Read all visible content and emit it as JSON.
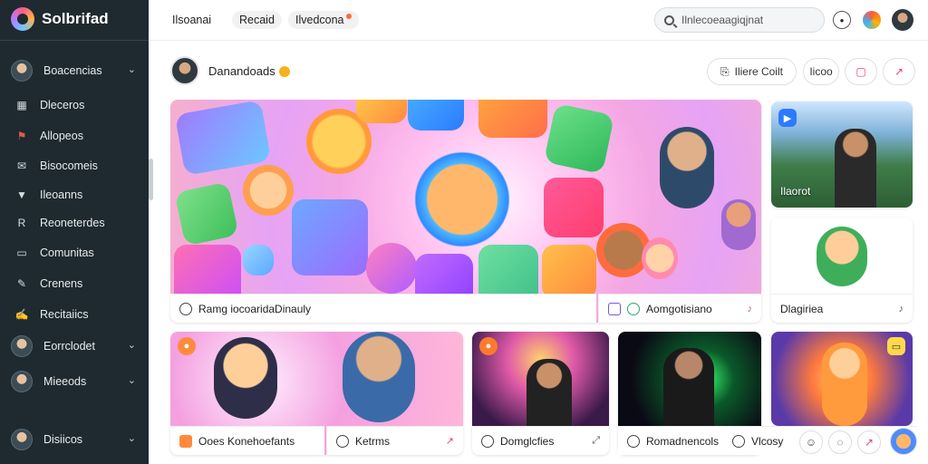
{
  "app": {
    "brand": "Solbrifad"
  },
  "sidebar": {
    "items": [
      {
        "label": "Boacencias",
        "type": "group"
      },
      {
        "label": "Dleceros",
        "type": "item",
        "icon": "▦"
      },
      {
        "label": "Allopeos",
        "type": "item",
        "icon": "⚑"
      },
      {
        "label": "Bisocomeis",
        "type": "item",
        "icon": "✉"
      },
      {
        "label": "Ileoanns",
        "type": "item",
        "icon": "▼"
      },
      {
        "label": "Reoneterdes",
        "type": "item",
        "icon": "R"
      },
      {
        "label": "Comunitas",
        "type": "item",
        "icon": "▭"
      },
      {
        "label": "Crenens",
        "type": "item",
        "icon": "✎"
      },
      {
        "label": "Recitaiics",
        "type": "item",
        "icon": "✍"
      },
      {
        "label": "Eorrclodet",
        "type": "group"
      },
      {
        "label": "Mieeods",
        "type": "group"
      },
      {
        "label": "Disiicos",
        "type": "group"
      }
    ]
  },
  "topbar": {
    "tabs": [
      "Ilsoanai",
      "Recaid",
      "Ilvedcona"
    ],
    "search_placeholder": "Ilnlecoeaagiqjnat"
  },
  "header": {
    "channel_name": "Danandoads",
    "btn_more": "Iliere Coilt",
    "btn_small": "Iicoo"
  },
  "cards": {
    "hero": {
      "label": "Ramg iocoaridaDinauly"
    },
    "hero_sub": {
      "label": "Aomgotisiano"
    },
    "landscape": {
      "label": "Ilaorot"
    },
    "small_right": {
      "label": "Dlagiriea"
    },
    "row": [
      {
        "label": "Ooes Konehoefants"
      },
      {
        "label": "Ketrms"
      },
      {
        "label": "Domglcfies"
      },
      {
        "label": "Romadnencols"
      },
      {
        "label": "Vlcosy"
      }
    ]
  },
  "colors": {
    "sidebar_bg": "#1f2a30",
    "accent": "#ff5a8a"
  }
}
